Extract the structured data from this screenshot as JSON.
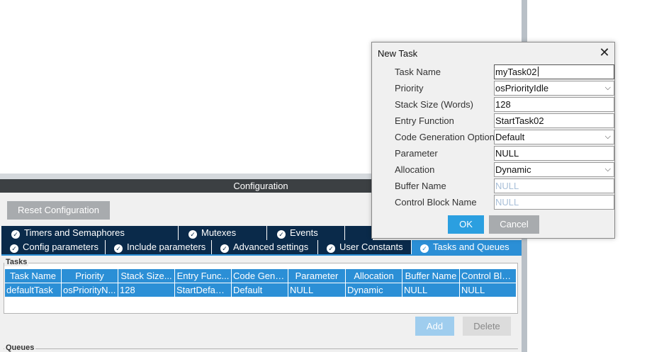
{
  "config": {
    "title": "Configuration",
    "reset_label": "Reset Configuration"
  },
  "tabs_row1": [
    "Timers and Semaphores",
    "Mutexes",
    "Events"
  ],
  "tabs_row2": [
    "Config parameters",
    "Include parameters",
    "Advanced settings",
    "User Constants",
    "Tasks and Queues"
  ],
  "active_tab": "Tasks and Queues",
  "tasks": {
    "legend": "Tasks",
    "columns": [
      "Task Name",
      "Priority",
      "Stack Size...",
      "Entry Func...",
      "Code Gene...",
      "Parameter",
      "Allocation",
      "Buffer Name",
      "Control Blo..."
    ],
    "rows": [
      [
        "defaultTask",
        "osPriorityN...",
        "128",
        "StartDefaul...",
        "Default",
        "NULL",
        "Dynamic",
        "NULL",
        "NULL"
      ]
    ],
    "add_label": "Add",
    "delete_label": "Delete"
  },
  "queues": {
    "legend": "Queues"
  },
  "dialog": {
    "title": "New Task",
    "close_glyph": "✕",
    "fields": [
      {
        "label": "Task Name",
        "value": "myTask02",
        "kind": "text"
      },
      {
        "label": "Priority",
        "value": "osPriorityIdle",
        "kind": "select"
      },
      {
        "label": "Stack Size (Words)",
        "value": "128",
        "kind": "text"
      },
      {
        "label": "Entry Function",
        "value": "StartTask02",
        "kind": "text"
      },
      {
        "label": "Code Generation Option",
        "value": "Default",
        "kind": "select"
      },
      {
        "label": "Parameter",
        "value": "NULL",
        "kind": "text"
      },
      {
        "label": "Allocation",
        "value": "Dynamic",
        "kind": "select"
      },
      {
        "label": "Buffer Name",
        "value": "NULL",
        "kind": "disabled"
      },
      {
        "label": "Control Block Name",
        "value": "NULL",
        "kind": "disabled"
      }
    ],
    "ok_label": "OK",
    "cancel_label": "Cancel"
  },
  "icons": {
    "check": "check-circle-icon",
    "dropdown": "chevron-down-icon",
    "close": "close-icon"
  },
  "colors": {
    "tab_dark": "#0a2a4a",
    "accent": "#2b8fd6",
    "ok": "#2b9fe0"
  }
}
